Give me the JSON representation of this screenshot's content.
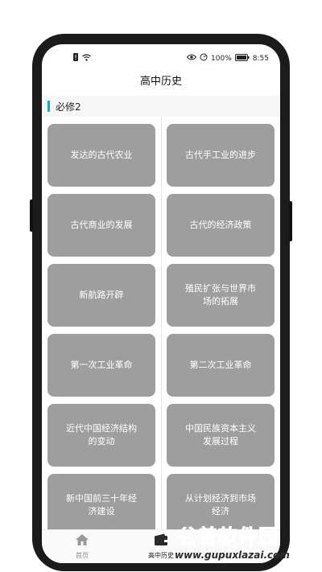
{
  "statusbar": {
    "battery_percent": "100%",
    "time": "8:55"
  },
  "header": {
    "title": "高中历史"
  },
  "section": {
    "title": "必修2"
  },
  "cards": [
    {
      "label": "发达的古代农业"
    },
    {
      "label": "古代手工业的进步"
    },
    {
      "label": "古代商业的发展"
    },
    {
      "label": "古代的经济政策"
    },
    {
      "label": "新航路开辟"
    },
    {
      "label": "殖民扩张与世界市场的拓展"
    },
    {
      "label": "第一次工业革命"
    },
    {
      "label": "第二次工业革命"
    },
    {
      "label": "近代中国经济结构的变动"
    },
    {
      "label": "中国民族资本主义发展过程"
    },
    {
      "label": "新中国前三十年经济建设"
    },
    {
      "label": "从计划经济到市场经济"
    }
  ],
  "tabs": [
    {
      "label": "首页",
      "icon": "home-icon",
      "active": false
    },
    {
      "label": "高中历史",
      "icon": "book-icon",
      "active": true
    }
  ],
  "watermark": {
    "title": "谷普软件园",
    "url": "www.gupuxlazai.com"
  },
  "colors": {
    "accent": "#1aa7c9",
    "card": "#9e9e9e",
    "watermark_green": "#2fb84a"
  }
}
